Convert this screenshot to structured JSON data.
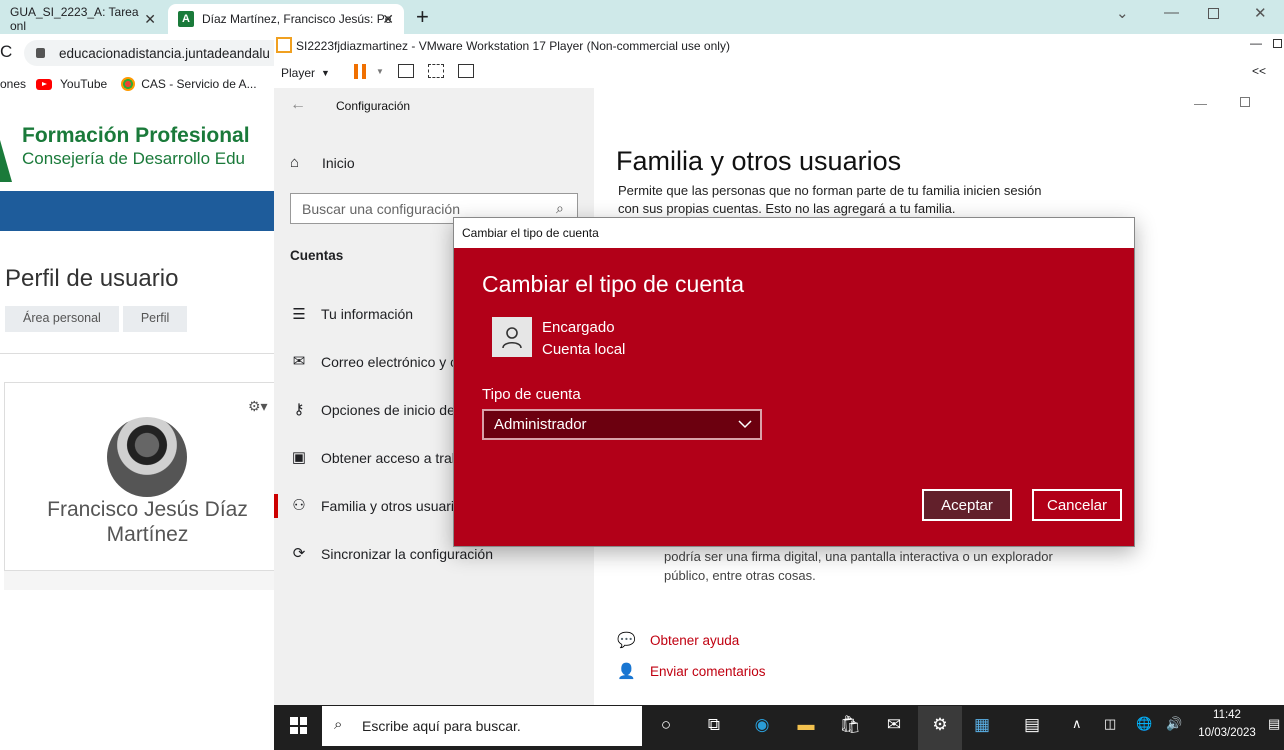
{
  "browser": {
    "tabs": [
      {
        "label": "GUA_SI_2223_A: Tarea onl"
      },
      {
        "label": "Díaz Martínez, Francisco Jesús: Pe",
        "favicon": "A"
      }
    ],
    "url": "educacionadistancia.juntadeandalu",
    "bookmarks": [
      {
        "label": "ones"
      },
      {
        "label": "YouTube"
      },
      {
        "label": "CAS - Servicio de A..."
      }
    ]
  },
  "moodle": {
    "org_title": "Formación Profesional",
    "org_subtitle": "Consejería de Desarrollo Edu",
    "page_title": "Perfil de usuario",
    "breadcrumb": [
      "Área personal",
      "Perfil"
    ],
    "user_full_name": "Francisco Jesús Díaz Martínez",
    "colors": {
      "brand_green": "#1a7a3a",
      "nav_blue": "#1e5c9b"
    }
  },
  "vmware": {
    "window_title": "SI2223fjdiazmartinez - VMware Workstation 17 Player (Non-commercial use only)",
    "player_menu": "Player",
    "collapse_label": "<<"
  },
  "settings": {
    "caption": "Configuración",
    "home_label": "Inicio",
    "search_placeholder": "Buscar una configuración",
    "section_heading": "Cuentas",
    "nav": [
      {
        "label": "Tu información",
        "icon": "person-card-icon"
      },
      {
        "label": "Correo electrónico y c",
        "icon": "mail-icon"
      },
      {
        "label": "Opciones de inicio de",
        "icon": "key-icon"
      },
      {
        "label": "Obtener acceso a trab",
        "icon": "briefcase-icon"
      },
      {
        "label": "Familia y otros usuario",
        "icon": "person-add-icon"
      },
      {
        "label": "Sincronizar la configuración",
        "icon": "sync-icon"
      }
    ],
    "page_heading": "Familia y otros usuarios",
    "description_top": "Permite que las personas que no forman parte de tu familia inicien sesión con sus propias cuentas. Esto no las agregará a tu familia.",
    "description_bottom": "podría ser una firma digital, una pantalla interactiva o un explorador público, entre otras cosas.",
    "help_links": [
      {
        "label": "Obtener ayuda"
      },
      {
        "label": "Enviar comentarios"
      }
    ]
  },
  "dialog": {
    "window_title": "Cambiar el tipo de cuenta",
    "heading": "Cambiar el tipo de cuenta",
    "account_name": "Encargado",
    "account_kind": "Cuenta local",
    "type_label": "Tipo de cuenta",
    "type_selected": "Administrador",
    "ok_label": "Aceptar",
    "cancel_label": "Cancelar",
    "colors": {
      "background": "#b20018",
      "select_bg": "#6c000f",
      "ok_bg": "#62202b"
    }
  },
  "taskbar": {
    "search_placeholder": "Escribe aquí para buscar.",
    "time": "11:42",
    "date": "10/03/2023"
  }
}
